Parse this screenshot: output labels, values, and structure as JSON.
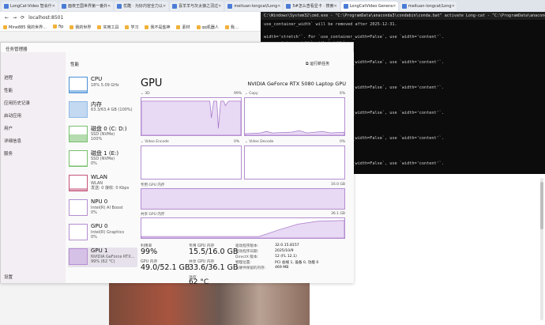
{
  "browser": {
    "tabs": [
      {
        "label": "LongCat-Video 智会什",
        "active": false
      },
      {
        "label": "面夜王国世界第一番外",
        "active": false
      },
      {
        "label": "优酷 · 为好内容全力以",
        "active": false
      },
      {
        "label": "喜羊羊与灰太狼之羽过",
        "active": false
      },
      {
        "label": "meituan-longcat/Long",
        "active": false
      },
      {
        "label": "5#怎么查看显卡 · 搜索",
        "active": false
      },
      {
        "label": "LongCatVideo Genera",
        "active": true
      },
      {
        "label": "meituan-longcat/Long",
        "active": false
      }
    ],
    "url": "localhost:8501",
    "bookmarks": [
      "Mine885 我的世界…",
      "fip",
      "我的世界",
      "实用工具",
      "学习",
      "我不是盐神",
      "素材",
      "qq机器人",
      "我…"
    ]
  },
  "terminal": {
    "title": "C:\\Windows\\System32\\cmd.exe - \"C:\\ProgramData\\anaconda3\\condabin\\conda.bat\" activate Long-cat - \"C:\\ProgramData\\anaconda3\\condabin\\conda...",
    "lines": [
      "use_container_width` will be removed after 2025-12-31.",
      "",
      "width='stretch'`. For `use_container_width=False`, use `width='content'`.",
      "use_container_width` with `width`.",
      "after 2025-12-31.",
      "",
      "width='stretch'`. For `use_container_width=False`, use `width='content'`.",
      "use_container_width` with `width`.",
      "after 2025-12-31.",
      "",
      "width='stretch'`. For `use_container_width=False`, use `width='content'`.",
      "use_container_width` with `width`.",
      "after 2025-12-31.",
      "",
      "width='stretch'`. For `use_container_width=False`, use `width='content'`.",
      "use_container_width` with `width`.",
      "after 2025-12-31.",
      "",
      "width='stretch'`. For `use_container_width=False`, use `width='content'`.",
      "use_container_width` with `width`.",
      "after 2025-12-31.",
      "",
      "width='stretch'`. For `use_container_width=False`, use `width='content'`.",
      "use_container_width` with `width`.",
      "after 2025-12-31."
    ]
  },
  "taskmanager": {
    "title": "任务管理器",
    "nav": [
      "进程",
      "性能",
      "应用历史记录",
      "启动应用",
      "用户",
      "详细信息",
      "服务"
    ],
    "settings": "设置",
    "header": "性能",
    "run_task": "运行新任务",
    "side": [
      {
        "name": "CPU",
        "sub": "18%  5.09 GHz",
        "color": "#4b8fd6",
        "level": 0.18
      },
      {
        "name": "内存",
        "sub": "63.3/63.4 GB (100%)",
        "color": "#8fb9e6",
        "level": 0.98
      },
      {
        "name": "磁盘 0 (C: D:)",
        "sub": "SSD (NVMe)\n100%",
        "color": "#78c06e",
        "level": 0.45
      },
      {
        "name": "磁盘 1 (E:)",
        "sub": "SSD (NVMe)\n0%",
        "color": "#78c06e",
        "level": 0.05
      },
      {
        "name": "WLAN",
        "sub": "WLAN\n发送: 0 接收: 0 Kbps",
        "color": "#c5537a",
        "level": 0.15
      },
      {
        "name": "NPU 0",
        "sub": "Intel(R) AI Boost\n0%",
        "color": "#b48ed1",
        "level": 0.0
      },
      {
        "name": "GPU 0",
        "sub": "Intel(R) Graphics\n0%",
        "color": "#b48ed1",
        "level": 0.0
      },
      {
        "name": "GPU 1",
        "sub": "NVIDIA GeForce RTX...\n99% (62 °C)",
        "color": "#b48ed1",
        "level": 0.99
      }
    ],
    "gpu": {
      "title": "GPU",
      "model": "NVIDIA GeForce RTX 5080 Laptop GPU",
      "engines": [
        {
          "name": "3D",
          "pct": "99%"
        },
        {
          "name": "Copy",
          "pct": "6%"
        },
        {
          "name": "Video Encode",
          "pct": "0%"
        },
        {
          "name": "Video Decode",
          "pct": "0%"
        }
      ],
      "dedicated_label": "专用 GPU 内存",
      "dedicated_max": "16.0 GB",
      "shared_label": "共享 GPU 内存",
      "shared_max": "36.1 GB",
      "stats": {
        "util_label": "利用率",
        "util": "99%",
        "ded_label": "专用 GPU 内存",
        "ded": "15.5/16.0 GB",
        "gpu_mem_label": "GPU 内存",
        "gpu_mem": "49.0/52.1 GB",
        "shared_label": "共享 GPU 内存",
        "shared": "33.6/36.1 GB",
        "temp_label": "温度",
        "temp": "62 °C"
      },
      "info": [
        {
          "k": "驱动程序版本:",
          "v": "32.0.15.8157"
        },
        {
          "k": "驱动程序日期:",
          "v": "2025/10/9"
        },
        {
          "k": "DirectX 版本:",
          "v": "12 (FL 12.1)"
        },
        {
          "k": "物理位置:",
          "v": "PCI 总线 1, 设备 0, 功能 0"
        },
        {
          "k": "为硬件保留的内存:",
          "v": "469 MB"
        }
      ]
    }
  }
}
